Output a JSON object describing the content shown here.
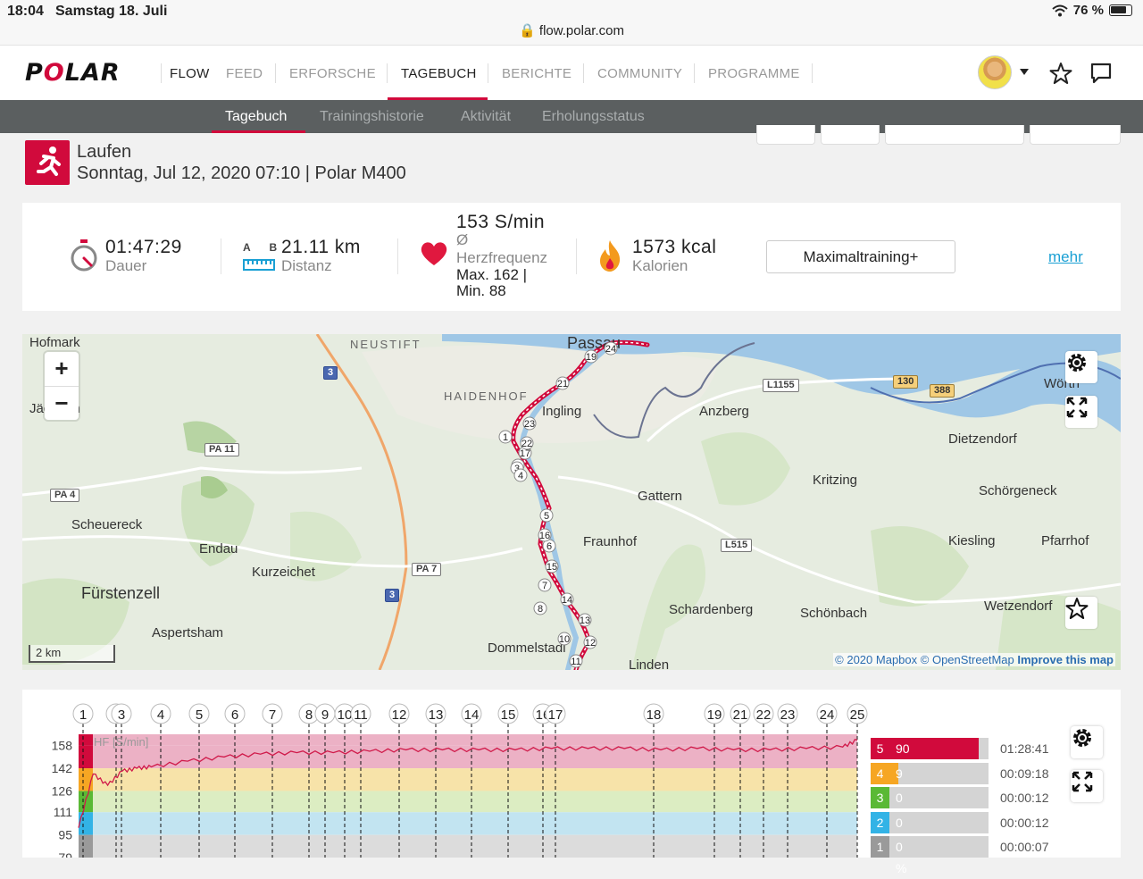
{
  "status_bar": {
    "time": "18:04",
    "date": "Samstag 18. Juli",
    "url": "flow.polar.com",
    "battery": "76 %"
  },
  "brand": {
    "logo": "POLAR",
    "accent": "#d10a3c"
  },
  "nav": {
    "items": [
      "FLOW",
      "FEED",
      "ERFORSCHE",
      "TAGEBUCH",
      "BERICHTE",
      "COMMUNITY",
      "PROGRAMME"
    ],
    "active": "TAGEBUCH"
  },
  "subnav": {
    "items": [
      "Tagebuch",
      "Trainingshistorie",
      "Aktivität",
      "Erholungsstatus"
    ],
    "active": "Tagebuch"
  },
  "session": {
    "sport": "Laufen",
    "date_line": "Sonntag, Jul 12, 2020 07:10 | Polar M400"
  },
  "summary": {
    "duration": "01:47:29",
    "duration_label": "Dauer",
    "distance_ab": "A B",
    "distance": "21.11 km",
    "distance_label": "Distanz",
    "hr_avg": "153 S/min",
    "hr_avg_symbol": "Ø",
    "hr_label": "Herzfrequenz",
    "hr_max": "Max. 162  |",
    "hr_min": "Min. 88",
    "calories": "1573 kcal",
    "calories_label": "Kalorien",
    "benefit": "Maximaltraining+",
    "more": "mehr"
  },
  "map": {
    "places": [
      "Hofmark",
      "NEUSTIFT",
      "Passau",
      "HAIDENHOF",
      "Ingling",
      "Anzberg",
      "Wörth",
      "Dietzendorf",
      "Jäckerth",
      "Scheuereck",
      "Endau",
      "Kurzeichet",
      "Fürstenzell",
      "Aspertsham",
      "Gattern",
      "Fraunhof",
      "Kritzing",
      "Schörgeneck",
      "Kiesling",
      "Pfarrhof",
      "Schardenberg",
      "Schönbach",
      "Wetzendorf",
      "Dommelstadl",
      "Linden"
    ],
    "roads": [
      "3",
      "PA 11",
      "PA 4",
      "PA 7",
      "3",
      "L1155",
      "130",
      "388",
      "L515"
    ],
    "scale": "2 km",
    "attribution_a": "© 2020 Mapbox",
    "attribution_b": "© OpenStreetMap",
    "attribution_c": "Improve this map",
    "zoom_in": "+",
    "zoom_out": "−",
    "route_color": "#d10a3c"
  },
  "hr_chart": {
    "series_label": "HF [S/min]",
    "yticks": [
      "158",
      "142",
      "126",
      "111",
      "95",
      "79"
    ],
    "laps": [
      "1",
      "2",
      "3",
      "4",
      "5",
      "6",
      "7",
      "8",
      "9",
      "10",
      "11",
      "12",
      "13",
      "14",
      "15",
      "16",
      "17",
      "18",
      "19",
      "21",
      "22",
      "23",
      "24",
      "25"
    ],
    "zones": [
      {
        "zone": "5",
        "pct": "90 %",
        "time": "01:28:41",
        "color": "#d10a3c",
        "fill": 0.9
      },
      {
        "zone": "4",
        "pct": "9 %",
        "time": "00:09:18",
        "color": "#f6a623",
        "fill": 0.09
      },
      {
        "zone": "3",
        "pct": "0 %",
        "time": "00:00:12",
        "color": "#5ab935",
        "fill": 0.0
      },
      {
        "zone": "2",
        "pct": "0 %",
        "time": "00:00:12",
        "color": "#33b3e6",
        "fill": 0.0
      },
      {
        "zone": "1",
        "pct": "0 %",
        "time": "00:00:07",
        "color": "#9a9a9a",
        "fill": 0.0
      }
    ]
  },
  "chart_data": {
    "type": "line",
    "title": "",
    "ylabel": "HF [S/min]",
    "ylim": [
      79,
      166
    ],
    "x": [
      0,
      2,
      4,
      6,
      8,
      10,
      15,
      20,
      25,
      30,
      35,
      40,
      45,
      50,
      55,
      60,
      65,
      70,
      75,
      80,
      85,
      90,
      95,
      100,
      105,
      107
    ],
    "series": [
      {
        "name": "HF [S/min]",
        "values": [
          100,
          138,
          130,
          140,
          142,
          143,
          147,
          150,
          152,
          153,
          153,
          154,
          155,
          155,
          155,
          155,
          156,
          156,
          156,
          155,
          156,
          155,
          155,
          156,
          157,
          162
        ]
      }
    ]
  }
}
